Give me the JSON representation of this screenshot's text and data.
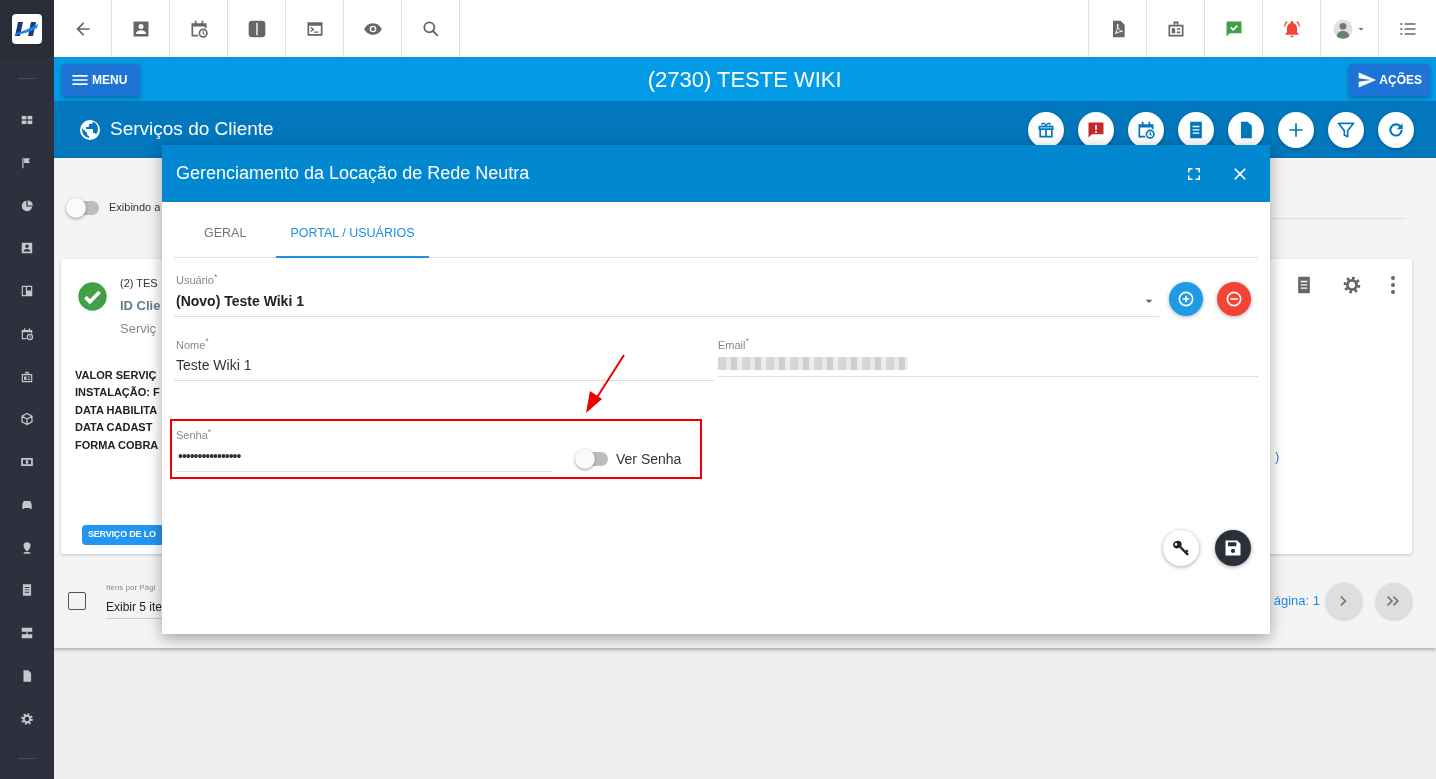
{
  "header": {
    "menu_button": "MENU",
    "title": "(2730) TESTE WIKI",
    "actions_button": "AÇÕES"
  },
  "subheader": {
    "title": "Serviços do Cliente"
  },
  "filter_toggle": {
    "label": "Exibindo a",
    "on": false
  },
  "service_card": {
    "title": "(2) TES",
    "id_line": "ID Clie",
    "type_line": "Serviç",
    "details": [
      "VALOR SERVIÇ",
      "INSTALAÇÃO: F",
      "DATA HABILITA",
      "DATA CADAST",
      "FORMA COBRA"
    ],
    "tag": "SERVIÇO DE LO",
    "link_fragment": ")"
  },
  "pagination": {
    "select_all_checked": false,
    "per_page_label": "Itens por Pági",
    "per_page_value": "Exibir 5 ite",
    "page_label": "ágina: 1"
  },
  "modal": {
    "title": "Gerenciamento da Locação de Rede Neutra",
    "tabs": [
      {
        "label": "GERAL",
        "selected": false
      },
      {
        "label": "PORTAL / USUÁRIOS",
        "selected": true
      }
    ],
    "usuario": {
      "label": "Usuário$^{*}$",
      "value": "(Novo) Teste Wiki 1"
    },
    "nome": {
      "label": "Nome$^{*}$",
      "value": "Teste Wiki 1"
    },
    "email": {
      "label": "Email$^{*}$",
      "redacted": true
    },
    "senha": {
      "label": "Senha$^{*}$",
      "value": "••••••••••••••••"
    },
    "show_password": {
      "label": "Ver Senha",
      "on": false
    }
  },
  "annotations": {
    "highlight_box": true,
    "pointer_arrow": true
  }
}
